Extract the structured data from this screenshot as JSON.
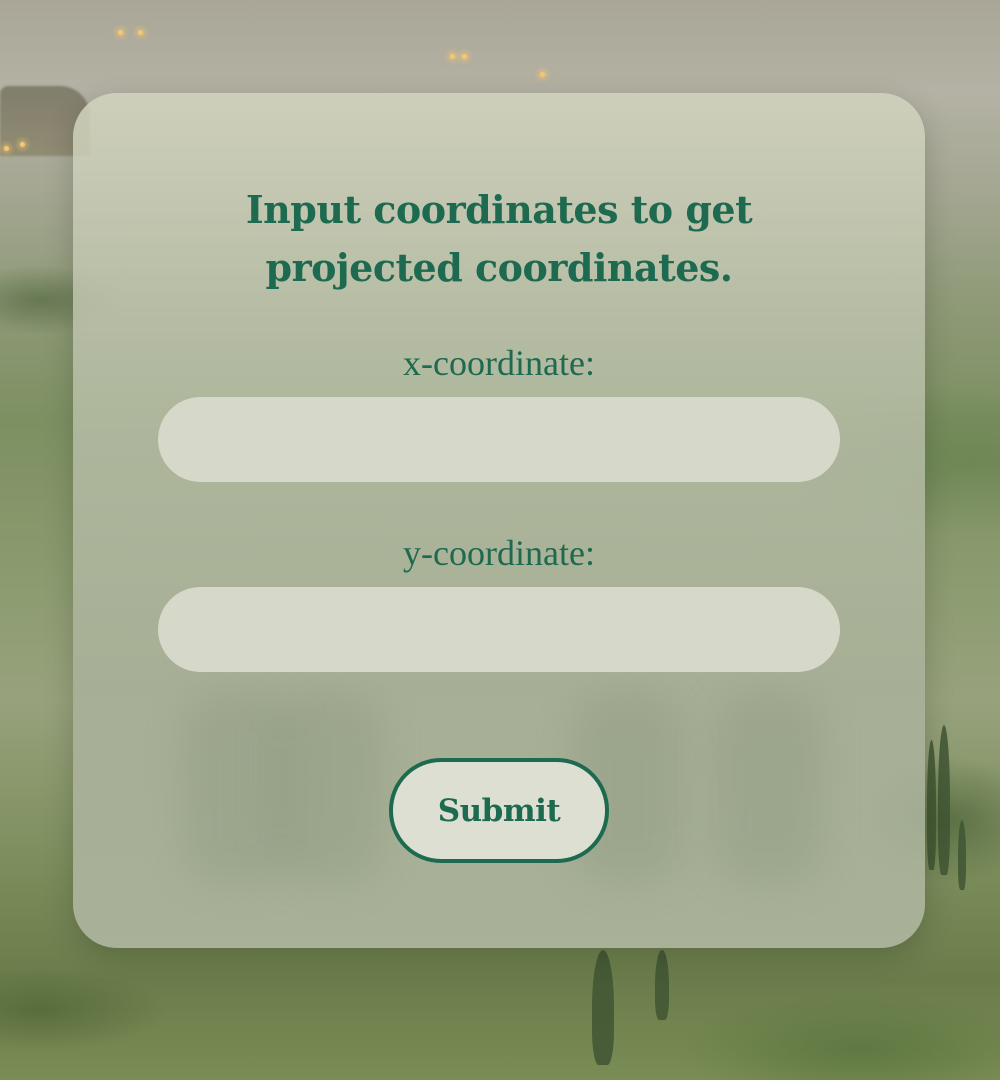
{
  "form": {
    "title": "Input coordinates to get projected coordinates.",
    "x_label": "x-coordinate:",
    "x_value": "",
    "y_label": "y-coordinate:",
    "y_value": "",
    "submit_label": "Submit"
  },
  "colors": {
    "accent": "#1e6a50",
    "input_background": "#d6d9c9",
    "card_background": "#c2c7b1"
  }
}
